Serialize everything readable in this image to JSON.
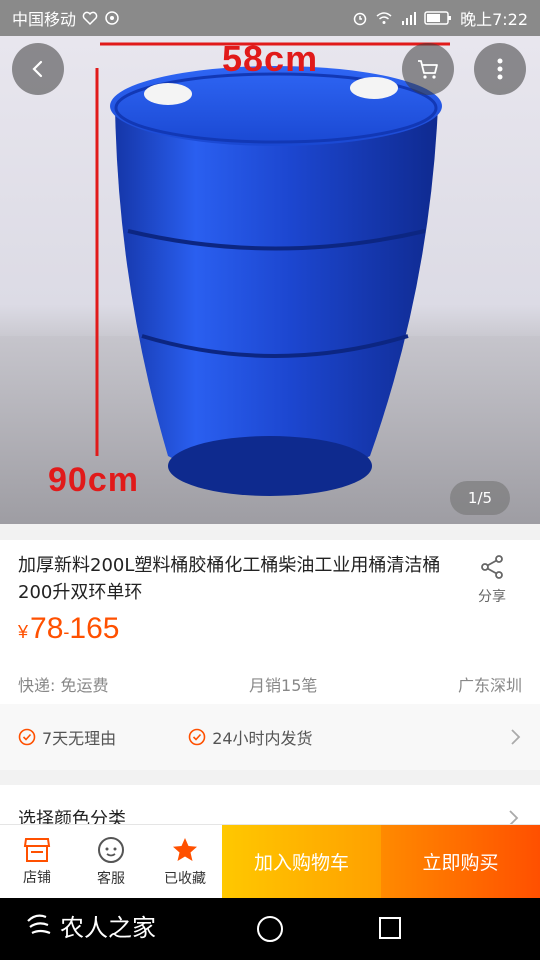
{
  "status_bar": {
    "carrier": "中国移动",
    "time": "晚上7:22",
    "icons": [
      "heart-rate-icon",
      "sync-icon",
      "alarm-icon",
      "wifi-icon",
      "signal-4g-icon",
      "battery-icon"
    ]
  },
  "gallery": {
    "dimension_top": "58cm",
    "dimension_side": "90cm",
    "page_indicator": "1/5",
    "product_color": "#1a4fd8"
  },
  "product": {
    "title": "加厚新料200L塑料桶胶桶化工桶柴油工业用桶清洁桶200升双环单环",
    "share_label": "分享",
    "currency": "¥",
    "price_low": "78",
    "price_sep": "-",
    "price_high": "165",
    "shipping": "快递: 免运费",
    "monthly_sales": "月销15笔",
    "location": "广东深圳"
  },
  "services": [
    {
      "label": "7天无理由"
    },
    {
      "label": "24小时内发货"
    }
  ],
  "choose_label": "选择颜色分类",
  "action_bar": {
    "store_label": "店铺",
    "service_label": "客服",
    "favorite_label": "已收藏",
    "add_cart_label": "加入购物车",
    "buy_now_label": "立即购买"
  },
  "nav_bar": {
    "brand": "农人之家"
  },
  "colors": {
    "accent": "#ff5000",
    "add_cart": "#ffb400",
    "buy_now": "#ff6a00"
  }
}
